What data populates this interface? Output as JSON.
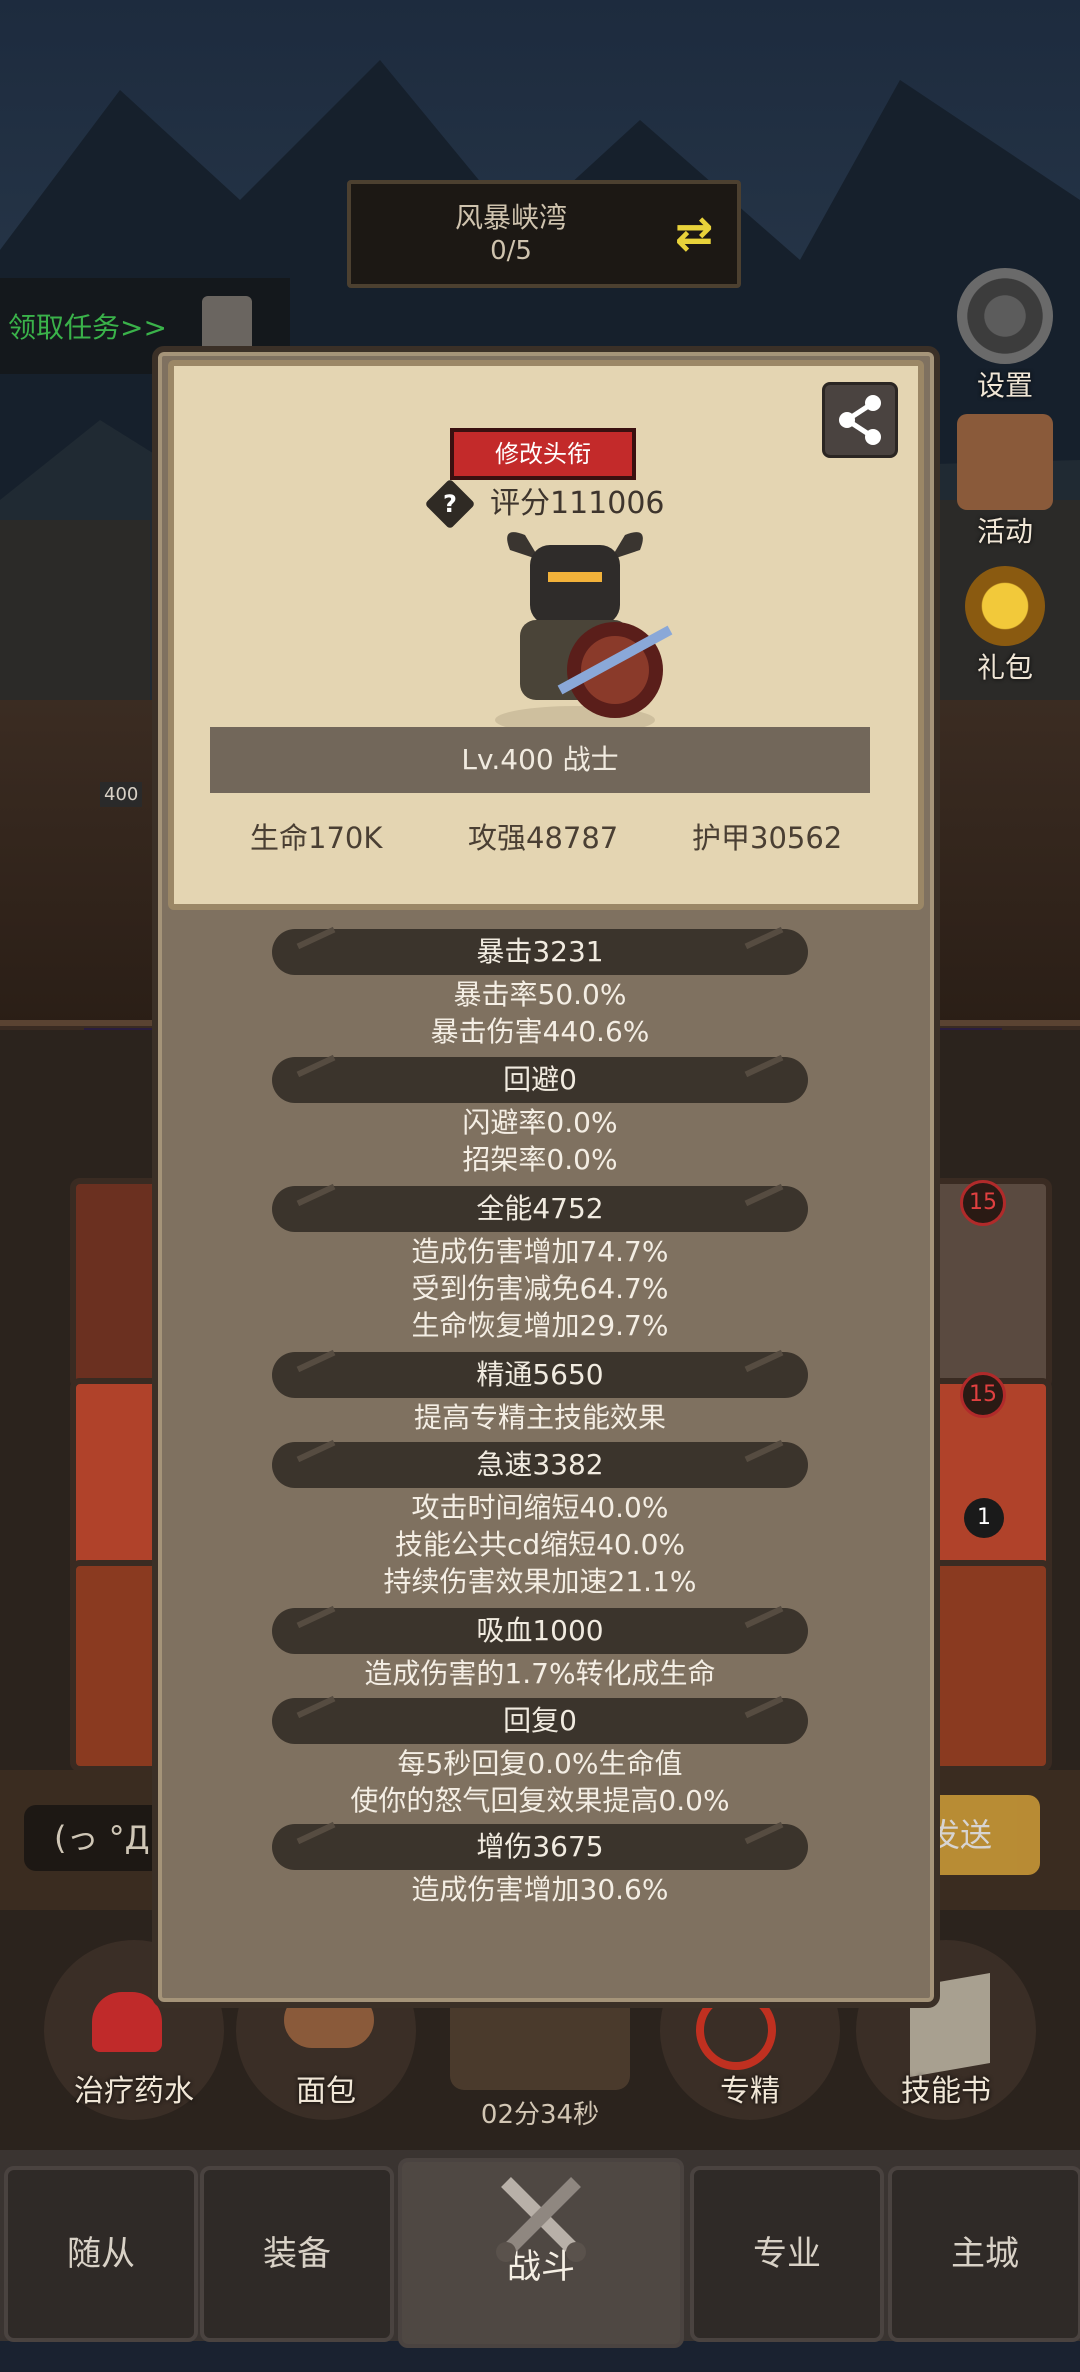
{
  "zone": {
    "name": "风暴峡湾",
    "progress": "0/5"
  },
  "quest": {
    "label": "领取任务>>"
  },
  "side_buttons": [
    {
      "label": "设置",
      "icon": "gear-icon"
    },
    {
      "label": "活动",
      "icon": "scroll-icon"
    },
    {
      "label": "礼包",
      "icon": "gift-pot-icon"
    }
  ],
  "bg_level_tag": "400",
  "profile": {
    "title_button": "修改头衔",
    "score": "评分111006",
    "level": "Lv.400 战士",
    "stats": {
      "hp": "生命170K",
      "attack": "攻强48787",
      "armor": "护甲30562"
    }
  },
  "sections": [
    {
      "header": "暴击3231",
      "lines": [
        "暴击率50.0%",
        "暴击伤害440.6%"
      ]
    },
    {
      "header": "回避0",
      "lines": [
        "闪避率0.0%",
        "招架率0.0%"
      ]
    },
    {
      "header": "全能4752",
      "lines": [
        "造成伤害增加74.7%",
        "受到伤害减免64.7%",
        "生命恢复增加29.7%"
      ]
    },
    {
      "header": "精通5650",
      "lines": [
        "提高专精主技能效果"
      ]
    },
    {
      "header": "急速3382",
      "lines": [
        "攻击时间缩短40.0%",
        "技能公共cd缩短40.0%",
        "持续伤害效果加速21.1%"
      ]
    },
    {
      "header": "吸血1000",
      "lines": [
        "造成伤害的1.7%转化成生命"
      ]
    },
    {
      "header": "回复0",
      "lines": [
        "每5秒回复0.0%生命值",
        "使你的怒气回复效果提高0.0%"
      ]
    },
    {
      "header": "增伤3675",
      "lines": [
        "造成伤害增加30.6%"
      ]
    }
  ],
  "chat": {
    "input_text": "(っ °Д",
    "send_label": "发送"
  },
  "shelf": {
    "items": [
      "治疗药水",
      "面包",
      "专精",
      "技能书"
    ],
    "timer": "02分34秒"
  },
  "nav": {
    "tabs": [
      "随从",
      "装备",
      "战斗",
      "专业",
      "主城"
    ],
    "active": "战斗"
  },
  "badges": [
    "15",
    "15",
    "1"
  ]
}
